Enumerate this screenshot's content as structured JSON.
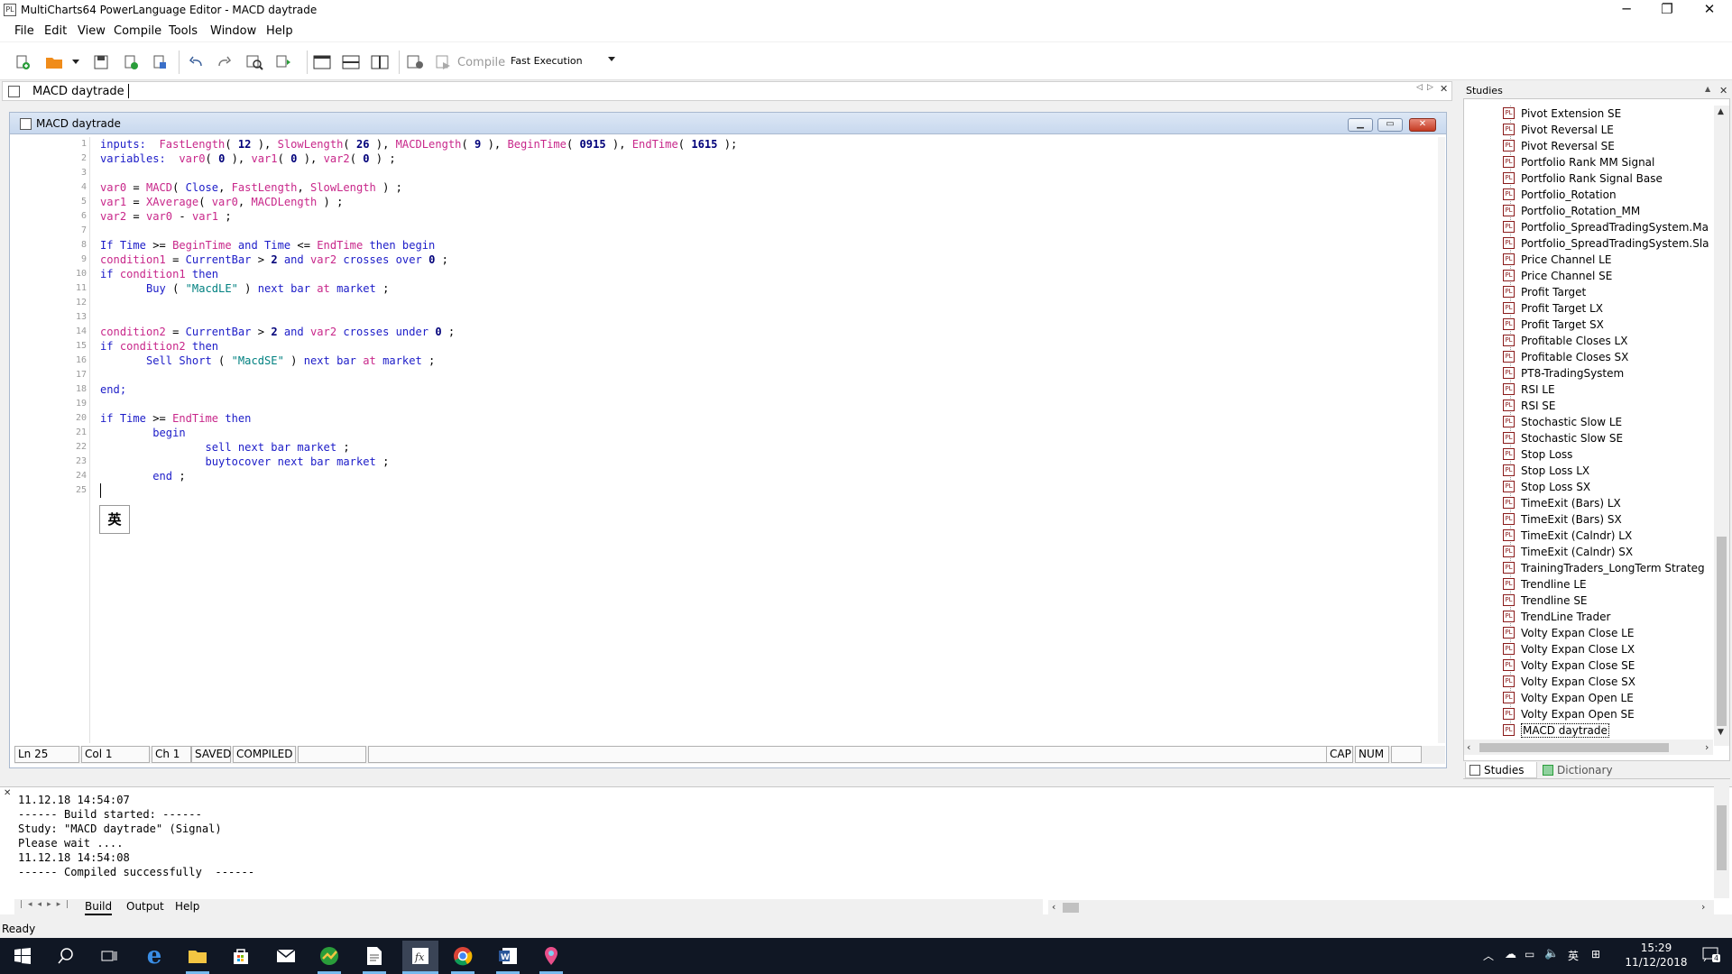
{
  "window": {
    "title": "MultiCharts64 PowerLanguage Editor - MACD daytrade",
    "minimize": "─",
    "restore": "❐",
    "close": "✕"
  },
  "menu": [
    "File",
    "Edit",
    "View",
    "Compile",
    "Tools",
    "Window",
    "Help"
  ],
  "toolbar": {
    "compile_label": "Compile",
    "execution_mode": "Fast Execution"
  },
  "document_tab": {
    "label": "MACD daytrade",
    "nav_left": "◁",
    "nav_right": "▷",
    "close": "✕"
  },
  "editor": {
    "window_title": "MACD daytrade",
    "min_btn": "▁",
    "max_btn": "▭",
    "close_btn": "✕",
    "line_numbers": [
      "1",
      "2",
      "3",
      "4",
      "5",
      "6",
      "7",
      "8",
      "9",
      "10",
      "11",
      "12",
      "13",
      "14",
      "15",
      "16",
      "17",
      "18",
      "19",
      "20",
      "21",
      "22",
      "23",
      "24",
      "25"
    ],
    "code_lines": [
      [
        [
          "kw",
          "inputs:  "
        ],
        [
          "fn",
          "FastLength"
        ],
        [
          "pl",
          "( "
        ],
        [
          "num",
          "12"
        ],
        [
          "pl",
          " ), "
        ],
        [
          "fn",
          "SlowLength"
        ],
        [
          "pl",
          "( "
        ],
        [
          "num",
          "26"
        ],
        [
          "pl",
          " ), "
        ],
        [
          "fn",
          "MACDLength"
        ],
        [
          "pl",
          "( "
        ],
        [
          "num",
          "9"
        ],
        [
          "pl",
          " ), "
        ],
        [
          "fn",
          "BeginTime"
        ],
        [
          "pl",
          "( "
        ],
        [
          "num",
          "0915"
        ],
        [
          "pl",
          " ), "
        ],
        [
          "fn",
          "EndTime"
        ],
        [
          "pl",
          "( "
        ],
        [
          "num",
          "1615"
        ],
        [
          "pl",
          " );"
        ]
      ],
      [
        [
          "kw",
          "variables:  "
        ],
        [
          "fn",
          "var0"
        ],
        [
          "pl",
          "( "
        ],
        [
          "num",
          "0"
        ],
        [
          "pl",
          " ), "
        ],
        [
          "fn",
          "var1"
        ],
        [
          "pl",
          "( "
        ],
        [
          "num",
          "0"
        ],
        [
          "pl",
          " ), "
        ],
        [
          "fn",
          "var2"
        ],
        [
          "pl",
          "( "
        ],
        [
          "num",
          "0"
        ],
        [
          "pl",
          " ) ;"
        ]
      ],
      [],
      [
        [
          "fn",
          "var0"
        ],
        [
          "pl",
          " = "
        ],
        [
          "fn",
          "MACD"
        ],
        [
          "pl",
          "( "
        ],
        [
          "kw",
          "Close"
        ],
        [
          "pl",
          ", "
        ],
        [
          "fn",
          "FastLength"
        ],
        [
          "pl",
          ", "
        ],
        [
          "fn",
          "SlowLength"
        ],
        [
          "pl",
          " ) ;"
        ]
      ],
      [
        [
          "fn",
          "var1"
        ],
        [
          "pl",
          " = "
        ],
        [
          "fn",
          "XAverage"
        ],
        [
          "pl",
          "( "
        ],
        [
          "fn",
          "var0"
        ],
        [
          "pl",
          ", "
        ],
        [
          "fn",
          "MACDLength"
        ],
        [
          "pl",
          " ) ;"
        ]
      ],
      [
        [
          "fn",
          "var2"
        ],
        [
          "pl",
          " = "
        ],
        [
          "fn",
          "var0"
        ],
        [
          "pl",
          " - "
        ],
        [
          "fn",
          "var1"
        ],
        [
          "pl",
          " ;"
        ]
      ],
      [],
      [
        [
          "kw",
          "If "
        ],
        [
          "kw",
          "Time"
        ],
        [
          "pl",
          " >= "
        ],
        [
          "fn",
          "BeginTime"
        ],
        [
          "kw",
          " and "
        ],
        [
          "kw",
          "Time"
        ],
        [
          "pl",
          " <= "
        ],
        [
          "fn",
          "EndTime"
        ],
        [
          "kw",
          " then begin"
        ]
      ],
      [
        [
          "fn",
          "condition1"
        ],
        [
          "pl",
          " = "
        ],
        [
          "kw",
          "CurrentBar"
        ],
        [
          "pl",
          " > "
        ],
        [
          "num",
          "2"
        ],
        [
          "kw",
          " and "
        ],
        [
          "fn",
          "var2"
        ],
        [
          "kw",
          " crosses over "
        ],
        [
          "num",
          "0"
        ],
        [
          "pl",
          " ;"
        ]
      ],
      [
        [
          "kw",
          "if "
        ],
        [
          "fn",
          "condition1"
        ],
        [
          "kw",
          " then"
        ]
      ],
      [
        [
          "pl",
          "       "
        ],
        [
          "kw",
          "Buy"
        ],
        [
          "pl",
          " ( "
        ],
        [
          "str",
          "\"MacdLE\""
        ],
        [
          "pl",
          " ) "
        ],
        [
          "kw",
          "next bar "
        ],
        [
          "fn",
          "at"
        ],
        [
          "kw",
          " market"
        ],
        [
          "pl",
          " ;"
        ]
      ],
      [],
      [],
      [
        [
          "fn",
          "condition2"
        ],
        [
          "pl",
          " = "
        ],
        [
          "kw",
          "CurrentBar"
        ],
        [
          "pl",
          " > "
        ],
        [
          "num",
          "2"
        ],
        [
          "kw",
          " and "
        ],
        [
          "fn",
          "var2"
        ],
        [
          "kw",
          " crosses under "
        ],
        [
          "num",
          "0"
        ],
        [
          "pl",
          " ;"
        ]
      ],
      [
        [
          "kw",
          "if "
        ],
        [
          "fn",
          "condition2"
        ],
        [
          "kw",
          " then"
        ]
      ],
      [
        [
          "pl",
          "       "
        ],
        [
          "kw",
          "Sell Short"
        ],
        [
          "pl",
          " ( "
        ],
        [
          "str",
          "\"MacdSE\""
        ],
        [
          "pl",
          " ) "
        ],
        [
          "kw",
          "next bar "
        ],
        [
          "fn",
          "at"
        ],
        [
          "kw",
          " market"
        ],
        [
          "pl",
          " ;"
        ]
      ],
      [],
      [
        [
          "kw",
          "end;"
        ]
      ],
      [],
      [
        [
          "kw",
          "if "
        ],
        [
          "kw",
          "Time"
        ],
        [
          "pl",
          " >= "
        ],
        [
          "fn",
          "EndTime"
        ],
        [
          "kw",
          " then"
        ]
      ],
      [
        [
          "pl",
          "        "
        ],
        [
          "kw",
          "begin"
        ]
      ],
      [
        [
          "pl",
          "                "
        ],
        [
          "kw",
          "sell next bar market"
        ],
        [
          "pl",
          " ;"
        ]
      ],
      [
        [
          "pl",
          "                "
        ],
        [
          "kw",
          "buytocover next bar market"
        ],
        [
          "pl",
          " ;"
        ]
      ],
      [
        [
          "pl",
          "        "
        ],
        [
          "kw",
          "end"
        ],
        [
          "pl",
          " ;"
        ]
      ],
      []
    ],
    "ime_indicator": "英"
  },
  "statusbar": {
    "line": "Ln 25",
    "col": "Col 1",
    "ch": "Ch 1",
    "saved": "SAVED",
    "compiled": "COMPILED",
    "cap": "CAP",
    "num": "NUM"
  },
  "studies": {
    "header": "Studies",
    "items": [
      "Pivot Extension SE",
      "Pivot Reversal LE",
      "Pivot Reversal SE",
      "Portfolio Rank MM Signal",
      "Portfolio Rank Signal Base",
      "Portfolio_Rotation",
      "Portfolio_Rotation_MM",
      "Portfolio_SpreadTradingSystem.Ma",
      "Portfolio_SpreadTradingSystem.Sla",
      "Price Channel LE",
      "Price Channel SE",
      "Profit Target",
      "Profit Target LX",
      "Profit Target SX",
      "Profitable Closes LX",
      "Profitable Closes SX",
      "PT8-TradingSystem",
      "RSI LE",
      "RSI SE",
      "Stochastic Slow LE",
      "Stochastic Slow SE",
      "Stop Loss",
      "Stop Loss LX",
      "Stop Loss SX",
      "TimeExit (Bars) LX",
      "TimeExit (Bars) SX",
      "TimeExit (Calndr) LX",
      "TimeExit (Calndr) SX",
      "TrainingTraders_LongTerm Strateg",
      "Trendline LE",
      "Trendline SE",
      "TrendLine Trader",
      "Volty Expan Close LE",
      "Volty Expan Close LX",
      "Volty Expan Close SE",
      "Volty Expan Close SX",
      "Volty Expan Open LE",
      "Volty Expan Open SE",
      "MACD daytrade"
    ],
    "selected_index": 38,
    "tab_studies": "Studies",
    "tab_dictionary": "Dictionary"
  },
  "output": {
    "lines": [
      "11.12.18 14:54:07",
      "------ Build started: ------",
      "Study: \"MACD daytrade\" (Signal)",
      "Please wait ....",
      "11.12.18 14:54:08",
      "------ Compiled successfully  ------"
    ],
    "tabs": [
      "Build",
      "Output",
      "Help"
    ]
  },
  "status": "Ready",
  "taskbar": {
    "time": "15:29",
    "date": "11/12/2018",
    "lang": "英",
    "notif_count": "4"
  },
  "colors": {
    "keyword": "#1c1cc8",
    "identifier": "#c8278a",
    "number": "#00007a",
    "string": "#008080",
    "taskbar": "#101724"
  }
}
